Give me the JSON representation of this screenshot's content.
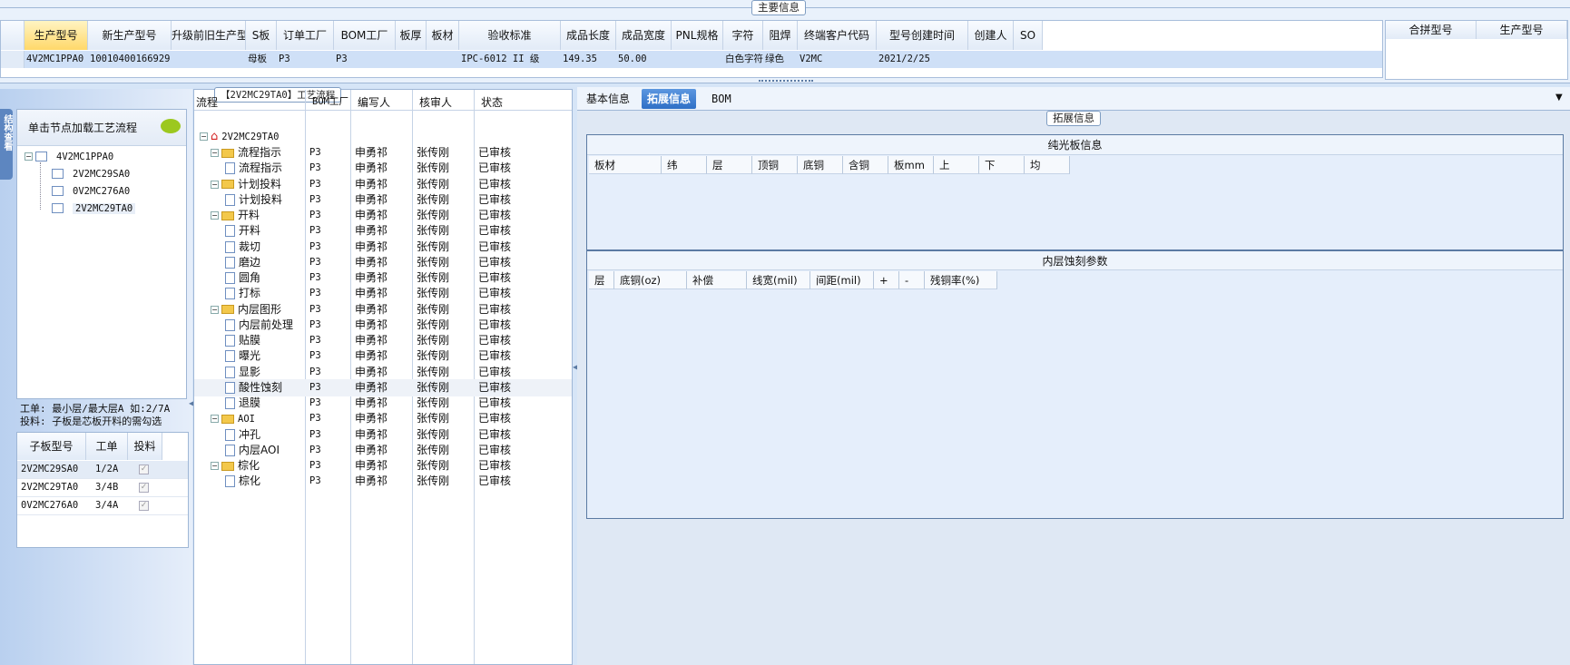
{
  "top_section_label": "主要信息",
  "main_columns": [
    "生产型号",
    "新生产型号",
    "升级前旧生产型号",
    "S板",
    "订单工厂",
    "BOM工厂",
    "板厚",
    "板材",
    "验收标准",
    "成品长度",
    "成品宽度",
    "PNL规格",
    "字符",
    "阻焊",
    "终端客户代码",
    "型号创建时间",
    "创建人",
    "SO"
  ],
  "main_row": [
    "4V2MC1PPA0",
    "10010400166929",
    "",
    "母板",
    "P3",
    "P3",
    "",
    "",
    "IPC-6012 II 级",
    "149.35",
    "50.00",
    "",
    "白色字符",
    "绿色",
    "V2MC",
    "2021/2/25",
    "",
    ""
  ],
  "merge_columns": [
    "合拼型号",
    "生产型号"
  ],
  "left_vertical_tab": "结构查看",
  "tree_hint": "单击节点加载工艺流程",
  "product_tree": {
    "root": "4V2MC1PPA0",
    "children": [
      "2V2MC29SA0",
      "0V2MC276A0",
      "2V2MC29TA0"
    ],
    "selected": "2V2MC29TA0"
  },
  "info_lines": [
    "工单: 最小层/最大层A 如:2/7A",
    "投料: 子板是芯板开料的需勾选"
  ],
  "sub_columns": [
    "子板型号",
    "工单",
    "投料"
  ],
  "sub_rows": [
    {
      "model": "2V2MC29SA0",
      "order": "1/2A",
      "checked": true
    },
    {
      "model": "2V2MC29TA0",
      "order": "3/4B",
      "checked": true
    },
    {
      "model": "0V2MC276A0",
      "order": "3/4A",
      "checked": true
    }
  ],
  "process_title": "【2V2MC29TA0】工艺流程",
  "process_columns": [
    "流程",
    "BOM工厂",
    "编写人",
    "核审人",
    "状态"
  ],
  "process_root": "2V2MC29TA0",
  "process_rows": [
    {
      "name": "流程指示",
      "type": "folder",
      "factory": "P3",
      "writer": "申勇祁",
      "reviewer": "张传刚",
      "status": "已审核"
    },
    {
      "name": "流程指示",
      "type": "doc",
      "factory": "P3",
      "writer": "申勇祁",
      "reviewer": "张传刚",
      "status": "已审核"
    },
    {
      "name": "计划投料",
      "type": "folder",
      "factory": "P3",
      "writer": "申勇祁",
      "reviewer": "张传刚",
      "status": "已审核"
    },
    {
      "name": "计划投料",
      "type": "doc",
      "factory": "P3",
      "writer": "申勇祁",
      "reviewer": "张传刚",
      "status": "已审核"
    },
    {
      "name": "开料",
      "type": "folder",
      "factory": "P3",
      "writer": "申勇祁",
      "reviewer": "张传刚",
      "status": "已审核"
    },
    {
      "name": "开料",
      "type": "doc",
      "factory": "P3",
      "writer": "申勇祁",
      "reviewer": "张传刚",
      "status": "已审核"
    },
    {
      "name": "裁切",
      "type": "doc",
      "factory": "P3",
      "writer": "申勇祁",
      "reviewer": "张传刚",
      "status": "已审核"
    },
    {
      "name": "磨边",
      "type": "doc",
      "factory": "P3",
      "writer": "申勇祁",
      "reviewer": "张传刚",
      "status": "已审核"
    },
    {
      "name": "圆角",
      "type": "doc",
      "factory": "P3",
      "writer": "申勇祁",
      "reviewer": "张传刚",
      "status": "已审核"
    },
    {
      "name": "打标",
      "type": "doc",
      "factory": "P3",
      "writer": "申勇祁",
      "reviewer": "张传刚",
      "status": "已审核"
    },
    {
      "name": "内层图形",
      "type": "folder",
      "factory": "P3",
      "writer": "申勇祁",
      "reviewer": "张传刚",
      "status": "已审核"
    },
    {
      "name": "内层前处理",
      "type": "doc",
      "factory": "P3",
      "writer": "申勇祁",
      "reviewer": "张传刚",
      "status": "已审核"
    },
    {
      "name": "贴膜",
      "type": "doc",
      "factory": "P3",
      "writer": "申勇祁",
      "reviewer": "张传刚",
      "status": "已审核"
    },
    {
      "name": "曝光",
      "type": "doc",
      "factory": "P3",
      "writer": "申勇祁",
      "reviewer": "张传刚",
      "status": "已审核"
    },
    {
      "name": "显影",
      "type": "doc",
      "factory": "P3",
      "writer": "申勇祁",
      "reviewer": "张传刚",
      "status": "已审核"
    },
    {
      "name": "酸性蚀刻",
      "type": "doc",
      "factory": "P3",
      "writer": "申勇祁",
      "reviewer": "张传刚",
      "status": "已审核",
      "selected": true
    },
    {
      "name": "退膜",
      "type": "doc",
      "factory": "P3",
      "writer": "申勇祁",
      "reviewer": "张传刚",
      "status": "已审核"
    },
    {
      "name": "AOI",
      "type": "folder",
      "factory": "P3",
      "writer": "申勇祁",
      "reviewer": "张传刚",
      "status": "已审核"
    },
    {
      "name": "冲孔",
      "type": "doc",
      "factory": "P3",
      "writer": "申勇祁",
      "reviewer": "张传刚",
      "status": "已审核"
    },
    {
      "name": "内层AOI",
      "type": "doc",
      "factory": "P3",
      "writer": "申勇祁",
      "reviewer": "张传刚",
      "status": "已审核"
    },
    {
      "name": "棕化",
      "type": "folder",
      "factory": "P3",
      "writer": "申勇祁",
      "reviewer": "张传刚",
      "status": "已审核"
    },
    {
      "name": "棕化",
      "type": "doc",
      "factory": "P3",
      "writer": "申勇祁",
      "reviewer": "张传刚",
      "status": "已审核"
    }
  ],
  "right_tabs": [
    "基本信息",
    "拓展信息",
    "BOM"
  ],
  "right_active_tab": 1,
  "ext_group_label": "拓展信息",
  "pure_board_title": "纯光板信息",
  "pure_board_columns": [
    "板材",
    "纬",
    "层",
    "顶铜",
    "底铜",
    "含铜",
    "板mm",
    "上",
    "下",
    "均"
  ],
  "inner_etch_title": "内层蚀刻参数",
  "inner_etch_columns": [
    "层",
    "底铜(oz)",
    "补偿",
    "线宽(mil)",
    "间距(mil)",
    "+",
    "-",
    "残铜率(%)"
  ]
}
